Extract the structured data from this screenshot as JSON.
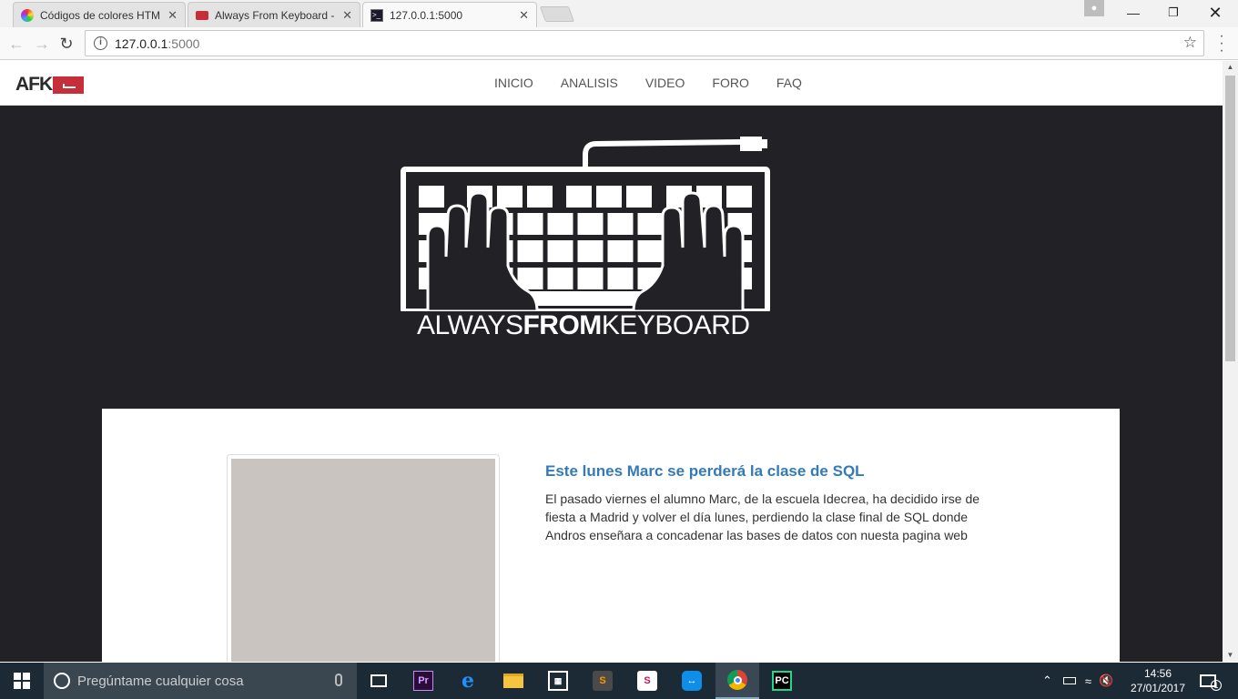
{
  "browser": {
    "tabs": [
      {
        "title": "Códigos de colores HTM",
        "icon": "color-wheel-icon",
        "active": false
      },
      {
        "title": "Always From Keyboard -",
        "icon": "afk-favicon-icon",
        "active": false
      },
      {
        "title": "127.0.0.1:5000",
        "icon": "terminal-icon",
        "active": true
      }
    ],
    "close_glyph": "✕",
    "url_host": "127.0.0.1",
    "url_port": ":5000"
  },
  "site": {
    "logo_text": "AFK",
    "nav": [
      "INICIO",
      "ANALISIS",
      "VIDEO",
      "FORO",
      "FAQ"
    ],
    "hero_title_1": "ALWAYS",
    "hero_title_2": "FROM",
    "hero_title_3": "KEYBOARD",
    "colors": {
      "hero_bg": "#222126",
      "link": "#337ab7",
      "logo_red": "#c62f3a"
    }
  },
  "article": {
    "title": "Este lunes Marc se perderá la clase de SQL",
    "body": "El pasado viernes el alumno Marc, de la escuela Idecrea, ha decidido irse de fiesta a Madrid y volver el día lunes, perdiendo la clase final de SQL donde Andros enseñara a concadenar las bases de datos con nuesta pagina web"
  },
  "taskbar": {
    "search_placeholder": "Pregúntame cualquier cosa",
    "time": "14:56",
    "date": "27/01/2017",
    "notifications": "1",
    "apps": [
      "task-view",
      "premiere",
      "edge",
      "file-explorer",
      "store",
      "sublime-text",
      "smartgit",
      "teamviewer",
      "chrome",
      "pycharm"
    ]
  }
}
